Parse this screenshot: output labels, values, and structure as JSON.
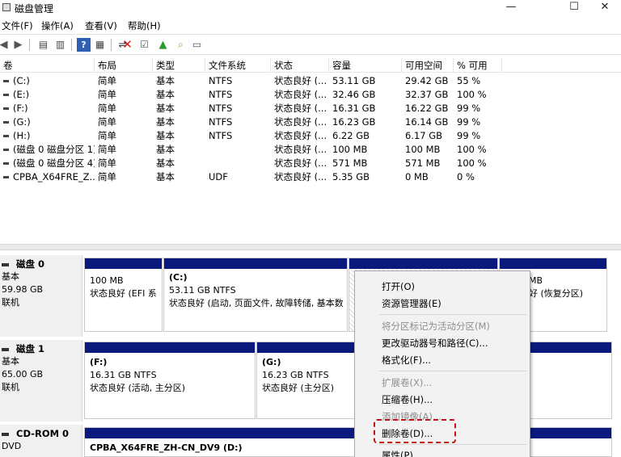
{
  "window": {
    "title": "磁盘管理",
    "minimize": "—",
    "maximize": "☐",
    "close": "✕"
  },
  "menu": [
    "文件(F)",
    "操作(A)",
    "查看(V)",
    "帮助(H)"
  ],
  "columns": [
    "卷",
    "布局",
    "类型",
    "文件系统",
    "状态",
    "容量",
    "可用空间",
    "% 可用"
  ],
  "volumes": [
    [
      "(C:)",
      "简单",
      "基本",
      "NTFS",
      "状态良好 (...",
      "53.11 GB",
      "29.42 GB",
      "55 %"
    ],
    [
      "(E:)",
      "简单",
      "基本",
      "NTFS",
      "状态良好 (...",
      "32.46 GB",
      "32.37 GB",
      "100 %"
    ],
    [
      "(F:)",
      "简单",
      "基本",
      "NTFS",
      "状态良好 (...",
      "16.31 GB",
      "16.22 GB",
      "99 %"
    ],
    [
      "(G:)",
      "简单",
      "基本",
      "NTFS",
      "状态良好 (...",
      "16.23 GB",
      "16.14 GB",
      "99 %"
    ],
    [
      "(H:)",
      "简单",
      "基本",
      "NTFS",
      "状态良好 (...",
      "6.22 GB",
      "6.17 GB",
      "99 %"
    ],
    [
      "(磁盘 0 磁盘分区 1)",
      "简单",
      "基本",
      "",
      "状态良好 (...",
      "100 MB",
      "100 MB",
      "100 %"
    ],
    [
      "(磁盘 0 磁盘分区 4)",
      "简单",
      "基本",
      "",
      "状态良好 (...",
      "571 MB",
      "571 MB",
      "100 %"
    ],
    [
      "CPBA_X64FRE_Z...",
      "简单",
      "基本",
      "UDF",
      "状态良好 (...",
      "5.35 GB",
      "0 MB",
      "0 %"
    ]
  ],
  "disks": [
    {
      "name": "磁盘 0",
      "type": "基本",
      "size": "59.98 GB",
      "status": "联机"
    },
    {
      "name": "磁盘 1",
      "type": "基本",
      "size": "65.00 GB",
      "status": "联机"
    },
    {
      "name": "CD-ROM 0",
      "type": "DVD",
      "size": "",
      "status": ""
    }
  ],
  "partitions": {
    "d0p1": {
      "line1": "100 MB",
      "line2": "状态良好 (EFI 系"
    },
    "d0c": {
      "name": "(C:)",
      "line1": "53.11 GB NTFS",
      "line2": "状态良好 (启动, 页面文件, 故障转储, 基本数"
    },
    "d0p4": {
      "line1": "MB",
      "line2": "好 (恢复分区)"
    },
    "d1f": {
      "name": "(F:)",
      "line1": "16.31 GB NTFS",
      "line2": "状态良好 (活动, 主分区)"
    },
    "d1g": {
      "name": "(G:)",
      "line1": "16.23 GB NTFS",
      "line2": "状态良好 (主分区)"
    },
    "cd": {
      "line1": "CPBA_X64FRE_ZH-CN_DV9  (D:)"
    }
  },
  "context_menu": [
    {
      "label": "打开(O)",
      "enabled": true
    },
    {
      "label": "资源管理器(E)",
      "enabled": true
    },
    {
      "label": "将分区标记为活动分区(M)",
      "enabled": false
    },
    {
      "label": "更改驱动器号和路径(C)...",
      "enabled": true
    },
    {
      "label": "格式化(F)...",
      "enabled": true
    },
    {
      "label": "扩展卷(X)...",
      "enabled": false
    },
    {
      "label": "压缩卷(H)...",
      "enabled": true
    },
    {
      "label": "添加镜像(A)...",
      "enabled": false
    },
    {
      "label": "删除卷(D)...",
      "enabled": true
    },
    {
      "label": "属性(P)",
      "enabled": true
    }
  ],
  "colors": {
    "partition_bar": "#0a1a7c",
    "highlight": "#c21515"
  }
}
